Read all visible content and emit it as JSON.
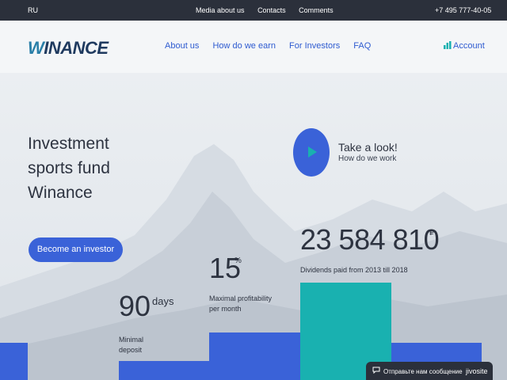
{
  "topbar": {
    "language": "RU",
    "links": [
      "Media about us",
      "Contacts",
      "Comments"
    ],
    "phone": "+7 495 777-40-05"
  },
  "header": {
    "logo": {
      "initial": "W",
      "rest": "INANCE"
    },
    "nav": [
      "About us",
      "How do we earn",
      "For Investors",
      "FAQ"
    ],
    "account": "Account",
    "account_icon": "bar-chart-icon"
  },
  "hero": {
    "title_lines": [
      "Investment",
      "sports fund",
      "Winance"
    ],
    "cta": "Become an investor",
    "video": {
      "title": "Take a look!",
      "subtitle": "How do we work"
    }
  },
  "stats": {
    "dividends": {
      "value": "23 584 810",
      "currency": "₽",
      "label": "Dividends paid from 2013 till 2018"
    },
    "profitability": {
      "value": "15",
      "unit": "%",
      "label": "Maximal profitability per month"
    },
    "deposit": {
      "value": "90",
      "unit": "days",
      "label": "Minimal deposit"
    }
  },
  "colors": {
    "accent": "#3a62d8",
    "teal": "#19b1b0",
    "dark": "#2b303b"
  },
  "chat": {
    "text": "Отправьте нам сообщение",
    "brand": "jivosite"
  }
}
